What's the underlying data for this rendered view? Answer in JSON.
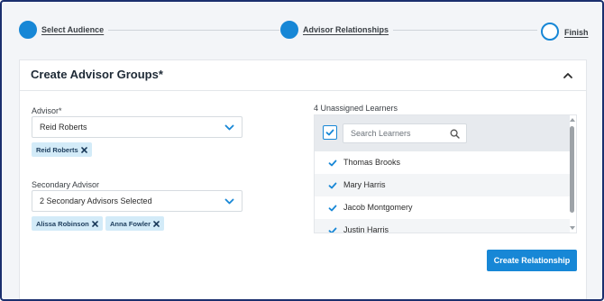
{
  "stepper": {
    "steps": [
      {
        "label": "Select Audience",
        "state": "complete"
      },
      {
        "label": "Advisor Relationships",
        "state": "current"
      },
      {
        "label": "Finish",
        "state": "pending"
      }
    ]
  },
  "card": {
    "title": "Create Advisor Groups*",
    "collapse_icon": "chevron-up-icon"
  },
  "advisor": {
    "label": "Advisor*",
    "value": "Reid Roberts",
    "tags": [
      "Reid Roberts"
    ]
  },
  "secondary_advisor": {
    "label": "Secondary Advisor",
    "value": "2 Secondary Advisors Selected",
    "tags": [
      "Alissa Robinson",
      "Anna Fowler"
    ]
  },
  "learners": {
    "title": "4 Unassigned Learners",
    "search_placeholder": "Search Learners",
    "select_all_checked": true,
    "items": [
      {
        "name": "Thomas Brooks",
        "checked": true
      },
      {
        "name": "Mary Harris",
        "checked": true
      },
      {
        "name": "Jacob Montgomery",
        "checked": true
      },
      {
        "name": "Justin Harris",
        "checked": true
      }
    ]
  },
  "actions": {
    "create_label": "Create Relationship"
  },
  "colors": {
    "accent": "#1787d6",
    "tag_bg": "#d3ebf8",
    "frame_border": "#1b2f6e",
    "background": "#f3f5f8"
  }
}
